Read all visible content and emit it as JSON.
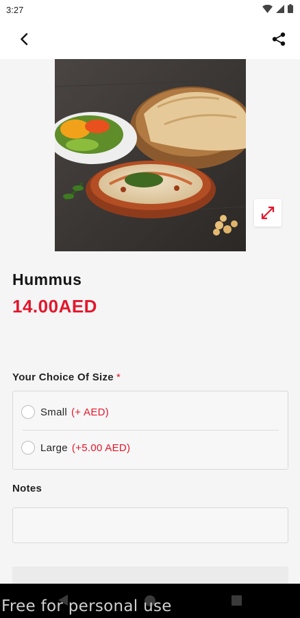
{
  "status_bar": {
    "time": "3:27",
    "icons": [
      "wifi-icon",
      "signal-icon",
      "battery-icon"
    ]
  },
  "app_bar": {
    "back_icon": "back-arrow-icon",
    "share_icon": "share-icon"
  },
  "product": {
    "image_icon": "expand-icon",
    "name": "Hummus",
    "price": "14.00AED"
  },
  "size_section": {
    "label": "Your Choice Of Size",
    "required_mark": "*",
    "options": [
      {
        "label": "Small",
        "price": "(+ AED)",
        "selected": false
      },
      {
        "label": "Large",
        "price": "(+5.00 AED)",
        "selected": false
      }
    ]
  },
  "notes": {
    "label": "Notes",
    "value": "",
    "placeholder": ""
  },
  "watermark": "Free for personal use",
  "colors": {
    "accent": "#e4162b",
    "background": "#f5f5f5",
    "border": "#d8d8d8"
  }
}
